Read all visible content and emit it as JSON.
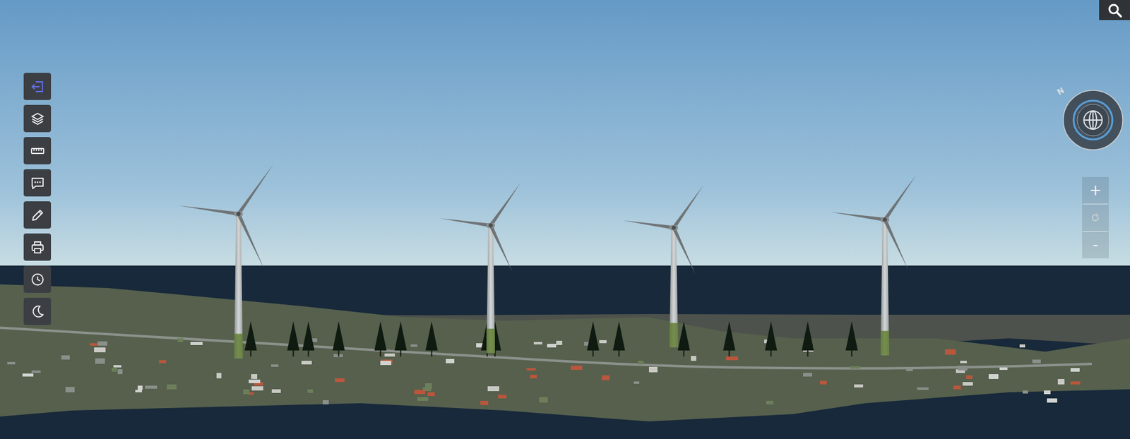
{
  "toolbar": [
    {
      "kind": "exit",
      "active": true
    },
    {
      "kind": "layers",
      "active": false
    },
    {
      "kind": "measure",
      "active": false
    },
    {
      "kind": "comment",
      "active": false
    },
    {
      "kind": "draw",
      "active": false
    },
    {
      "kind": "print",
      "active": false
    },
    {
      "kind": "time",
      "active": false
    },
    {
      "kind": "night",
      "active": false
    }
  ],
  "compass": {
    "label": "N"
  },
  "zoom": {
    "zoom_in": "+",
    "zoom_out": "-"
  }
}
